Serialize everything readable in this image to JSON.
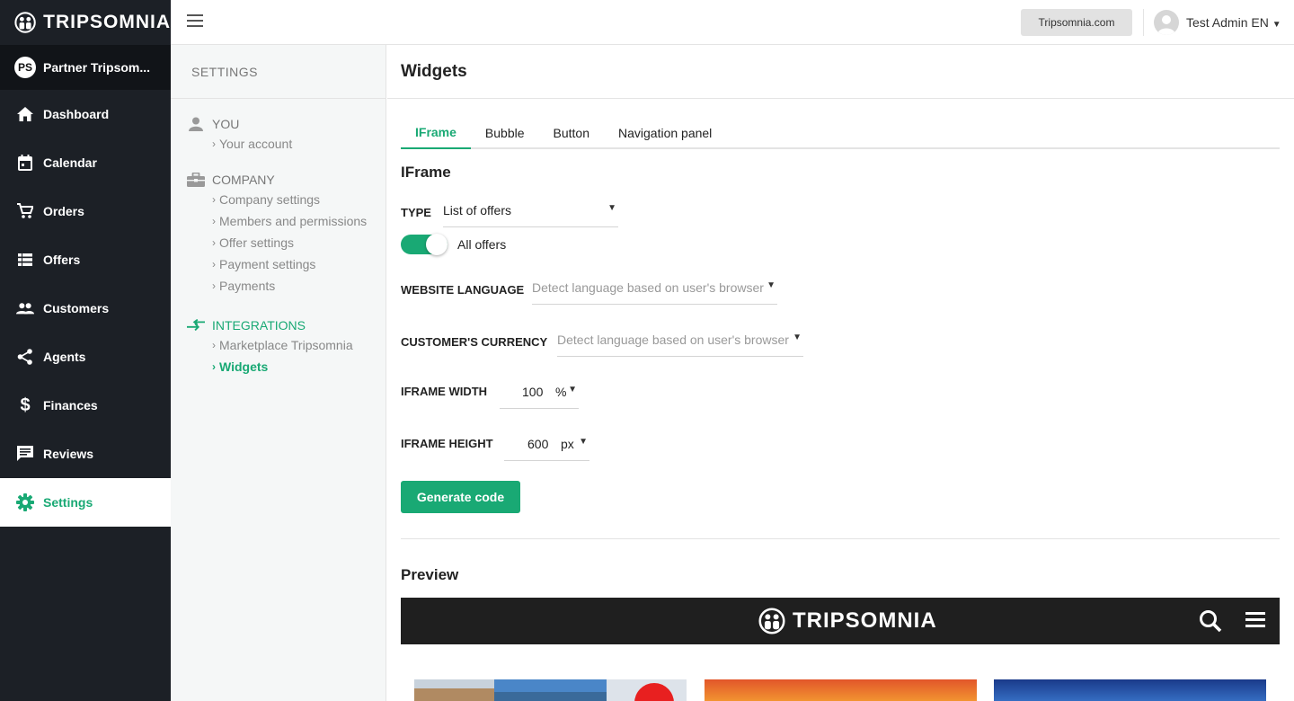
{
  "brand": {
    "name": "TRIPSOMNIA"
  },
  "partner": {
    "initials": "PS",
    "name": "Partner Tripsom..."
  },
  "nav": {
    "items": [
      {
        "label": "Dashboard",
        "icon": "home-icon"
      },
      {
        "label": "Calendar",
        "icon": "calendar-icon"
      },
      {
        "label": "Orders",
        "icon": "cart-icon"
      },
      {
        "label": "Offers",
        "icon": "list-icon"
      },
      {
        "label": "Customers",
        "icon": "people-icon"
      },
      {
        "label": "Agents",
        "icon": "share-icon"
      },
      {
        "label": "Finances",
        "icon": "dollar-icon"
      },
      {
        "label": "Reviews",
        "icon": "message-icon"
      },
      {
        "label": "Settings",
        "icon": "gear-icon",
        "active": true
      }
    ]
  },
  "topbar": {
    "site_button": "Tripsomnia.com",
    "user_name": "Test Admin EN"
  },
  "settings": {
    "header": "SETTINGS",
    "you": {
      "title": "YOU",
      "items": [
        "Your account"
      ]
    },
    "company": {
      "title": "COMPANY",
      "items": [
        "Company settings",
        "Members and permissions",
        "Offer settings",
        "Payment settings",
        "Payments"
      ]
    },
    "integrations": {
      "title": "INTEGRATIONS",
      "items": [
        "Marketplace Tripsomnia",
        "Widgets"
      ],
      "active": "Widgets"
    },
    "chevron": "›"
  },
  "main": {
    "title": "Widgets",
    "tabs": [
      "IFrame",
      "Bubble",
      "Button",
      "Navigation panel"
    ],
    "active_tab": "IFrame",
    "section_title": "IFrame",
    "type": {
      "label": "TYPE",
      "value": "List of offers"
    },
    "toggle": {
      "label": "All offers",
      "on": true
    },
    "website_language": {
      "label": "WEBSITE LANGUAGE",
      "value": "Detect language based on user's browser"
    },
    "customer_currency": {
      "label": "CUSTOMER'S CURRENCY",
      "value": "Detect language based on user's browser"
    },
    "iframe_width": {
      "label": "IFRAME WIDTH",
      "value": "100",
      "unit": "%"
    },
    "iframe_height": {
      "label": "IFRAME HEIGHT",
      "value": "600",
      "unit": "px"
    },
    "generate_button": "Generate code",
    "preview_title": "Preview",
    "preview_brand": "TRIPSOMNIA"
  },
  "colors": {
    "accent": "#19a974",
    "sidebar": "#1c2026"
  }
}
